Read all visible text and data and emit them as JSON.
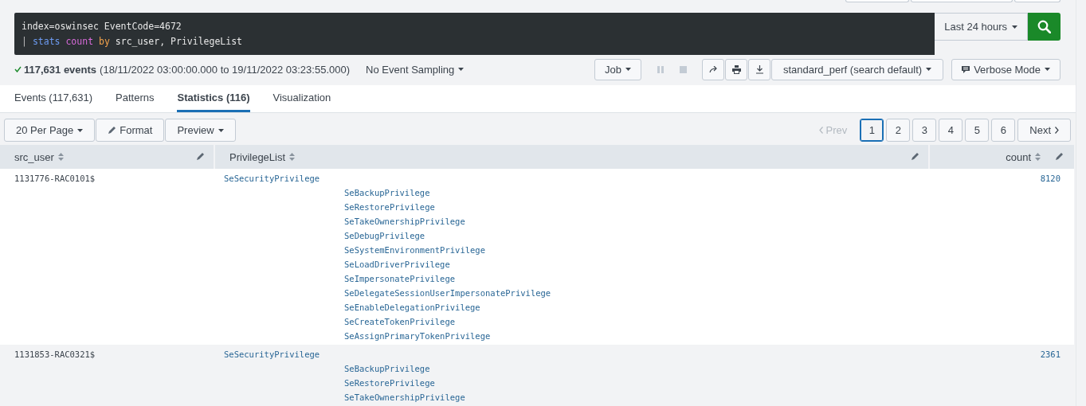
{
  "search": {
    "query_lines": [
      [
        {
          "text": "index=oswinsec EventCode=4672",
          "kind": "plain"
        }
      ],
      [
        {
          "text": "|",
          "kind": "pipe"
        },
        {
          "text": "stats",
          "kind": "command"
        },
        {
          "text": "count",
          "kind": "function"
        },
        {
          "text": "by",
          "kind": "keyword"
        },
        {
          "text": "src_user, PrivilegeList",
          "kind": "plain"
        }
      ]
    ],
    "time_range": "Last 24 hours"
  },
  "status": {
    "count": "117,631 events",
    "range": "(18/11/2022 03:00:00.000 to 19/11/2022 03:23:55.000)",
    "sampling": "No Event Sampling"
  },
  "job": {
    "job_label": "Job",
    "app": "standard_perf (search default)",
    "mode": "Verbose Mode"
  },
  "tabs": [
    {
      "label": "Events (117,631)",
      "selected": false
    },
    {
      "label": "Patterns",
      "selected": false
    },
    {
      "label": "Statistics (116)",
      "selected": true
    },
    {
      "label": "Visualization",
      "selected": false
    }
  ],
  "table_toolbar": {
    "per_page": "20 Per Page",
    "format": "Format",
    "preview": "Preview"
  },
  "pagination": {
    "prev": {
      "label": "Prev",
      "disabled": true
    },
    "pages": [
      {
        "label": "1",
        "selected": true
      },
      {
        "label": "2",
        "selected": false
      },
      {
        "label": "3",
        "selected": false
      },
      {
        "label": "4",
        "selected": false
      },
      {
        "label": "5",
        "selected": false
      },
      {
        "label": "6",
        "selected": false
      }
    ],
    "next": "Next"
  },
  "table": {
    "columns": [
      "src_user",
      "PrivilegeList",
      "count"
    ],
    "rows": [
      {
        "src_user": "1131776-RAC0101$",
        "privileges": [
          "SeSecurityPrivilege",
          "SeBackupPrivilege",
          "SeRestorePrivilege",
          "SeTakeOwnershipPrivilege",
          "SeDebugPrivilege",
          "SeSystemEnvironmentPrivilege",
          "SeLoadDriverPrivilege",
          "SeImpersonatePrivilege",
          "SeDelegateSessionUserImpersonatePrivilege",
          "SeEnableDelegationPrivilege",
          "SeCreateTokenPrivilege",
          "SeAssignPrimaryTokenPrivilege"
        ],
        "count": "8120"
      },
      {
        "src_user": "1131853-RAC0321$",
        "privileges": [
          "SeSecurityPrivilege",
          "SeBackupPrivilege",
          "SeRestorePrivilege",
          "SeTakeOwnershipPrivilege"
        ],
        "count": "2361"
      }
    ]
  }
}
